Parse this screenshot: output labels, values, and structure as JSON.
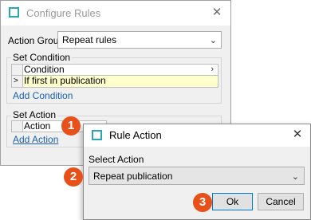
{
  "configure_window": {
    "title": "Configure Rules",
    "close_glyph": "✕",
    "action_group": {
      "label": "Action Group",
      "value": "Repeat rules"
    },
    "set_condition": {
      "group_label": "Set Condition",
      "header": "Condition",
      "row_marker": ">",
      "row_text": "If first in publication",
      "add_link": "Add Condition"
    },
    "set_action": {
      "group_label": "Set Action",
      "header": "Action",
      "add_link": "Add Action"
    }
  },
  "rule_dialog": {
    "title": "Rule Action",
    "close_glyph": "✕",
    "select_label": "Select Action",
    "selected_value": "Repeat publication",
    "ok_label": "Ok",
    "cancel_label": "Cancel"
  },
  "steps": [
    "1",
    "2",
    "3"
  ],
  "colors": {
    "step_marker": "#e8501a",
    "selected_row": "#ffffcc",
    "link": "#1a5fb4",
    "window_icon": "#2aa7b5"
  }
}
